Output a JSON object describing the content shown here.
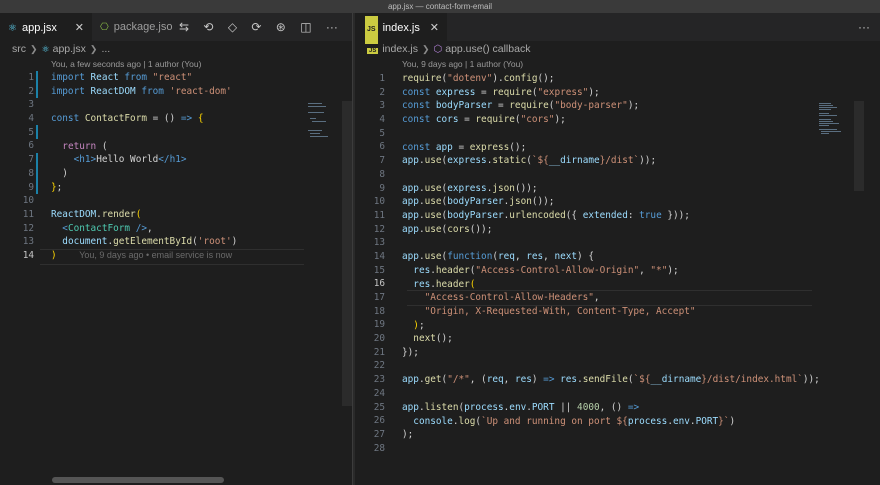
{
  "window": {
    "title": "app.jsx — contact-form-email"
  },
  "left": {
    "tabs": [
      {
        "label": "app.jsx",
        "active": true
      },
      {
        "label": "package.jso",
        "active": false
      }
    ],
    "breadcrumb": [
      "src",
      "app.jsx",
      "..."
    ],
    "blame_header": "You, a few seconds ago | 1 author (You)",
    "line_numbers": [
      "1",
      "2",
      "3",
      "4",
      "5",
      "6",
      "7",
      "8",
      "9",
      "10",
      "11",
      "12",
      "13",
      "14"
    ],
    "inline_blame": "You, 9 days ago • email service is now"
  },
  "right": {
    "tabs": [
      {
        "label": "index.js",
        "active": true
      }
    ],
    "breadcrumb": [
      "index.js",
      "app.use() callback"
    ],
    "blame_header": "You, 9 days ago | 1 author (You)",
    "line_numbers": [
      "1",
      "2",
      "3",
      "4",
      "5",
      "6",
      "7",
      "8",
      "9",
      "10",
      "11",
      "12",
      "13",
      "14",
      "15",
      "16",
      "17",
      "18",
      "19",
      "20",
      "21",
      "22",
      "23",
      "24",
      "25",
      "26",
      "27",
      "28"
    ]
  },
  "icons": {
    "react": "react-icon",
    "json": "json-icon",
    "js": "js-icon",
    "close": "close-icon",
    "more": "ellipsis-icon"
  }
}
